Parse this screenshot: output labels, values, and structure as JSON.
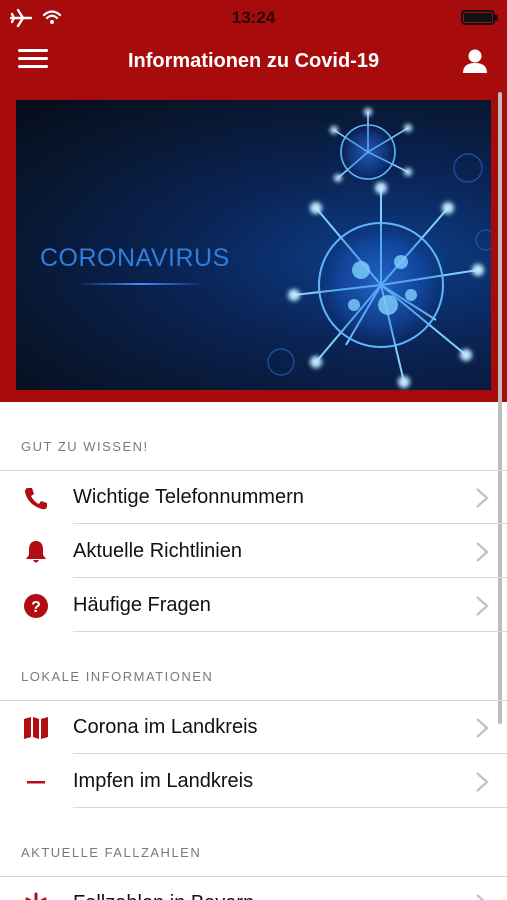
{
  "status_bar": {
    "time": "13:24"
  },
  "navbar": {
    "title": "Informationen zu Covid-19"
  },
  "banner": {
    "text": "CORONAVIRUS"
  },
  "colors": {
    "brand_red": "#a80b0b",
    "icon_red": "#b10d12",
    "banner_blue": "#2f7fe0"
  },
  "sections": [
    {
      "header": "GUT ZU WISSEN!",
      "items": [
        {
          "label": "Wichtige Telefonnummern",
          "icon": "phone-icon"
        },
        {
          "label": "Aktuelle Richtlinien",
          "icon": "bell-icon"
        },
        {
          "label": "Häufige Fragen",
          "icon": "question-icon"
        }
      ]
    },
    {
      "header": "LOKALE INFORMATIONEN",
      "items": [
        {
          "label": "Corona im Landkreis",
          "icon": "map-icon"
        },
        {
          "label": "Impfen im Landkreis",
          "icon": "minus-icon"
        }
      ]
    },
    {
      "header": "AKTUELLE FALLZAHLEN",
      "items": [
        {
          "label": "Fallzahlen in Bayern",
          "icon": "asterisk-icon"
        }
      ]
    }
  ]
}
